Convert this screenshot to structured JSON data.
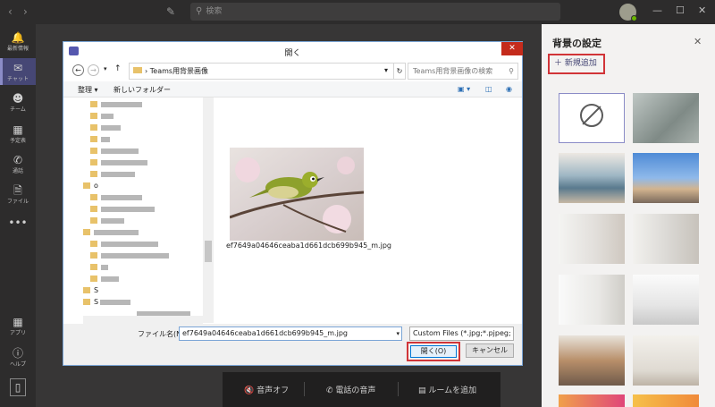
{
  "topbar": {
    "back_icon": "chevron-left-icon",
    "forward_icon": "chevron-right-icon",
    "compose_icon": "compose-icon",
    "search_placeholder": "検索",
    "window_controls": [
      "minimize-icon",
      "maximize-icon",
      "close-icon"
    ]
  },
  "rail": {
    "items": [
      {
        "label": "最新情報",
        "icon": "bell-icon"
      },
      {
        "label": "チャット",
        "icon": "chat-icon",
        "active": true
      },
      {
        "label": "チーム",
        "icon": "teams-icon"
      },
      {
        "label": "予定表",
        "icon": "calendar-icon"
      },
      {
        "label": "通話",
        "icon": "phone-icon"
      },
      {
        "label": "ファイル",
        "icon": "file-icon"
      },
      {
        "label": "",
        "icon": "more-icon"
      },
      {
        "label": "アプリ",
        "icon": "apps-icon"
      },
      {
        "label": "ヘルプ",
        "icon": "help-icon"
      }
    ],
    "active_color": "#464775"
  },
  "callbar": {
    "mute_label": "音声オフ",
    "phone_audio_label": "電話の音声",
    "add_room_label": "ルームを追加"
  },
  "panel": {
    "title": "背景の設定",
    "add_new_label": "新規追加",
    "highlight_color": "#d13438"
  },
  "dialog": {
    "title": "開く",
    "path_text": "Teams用背景画像",
    "search_placeholder": "Teams用背景画像の検索",
    "organize_label": "整理 ▾",
    "new_folder_label": "新しいフォルダー",
    "filename_label": "ファイル名(N):",
    "filename_value": "ef7649a04646ceaba1d661dcb699b945_m.jpg",
    "file_caption": "ef7649a04646ceaba1d661dcb699b945_m.jpg",
    "filter_value": "Custom Files (*.jpg;*.pjpeg;",
    "open_label": "開く(O)",
    "cancel_label": "キャンセル",
    "tree_first_folder": "o",
    "tree_s1": "S",
    "tree_s2": "S"
  }
}
